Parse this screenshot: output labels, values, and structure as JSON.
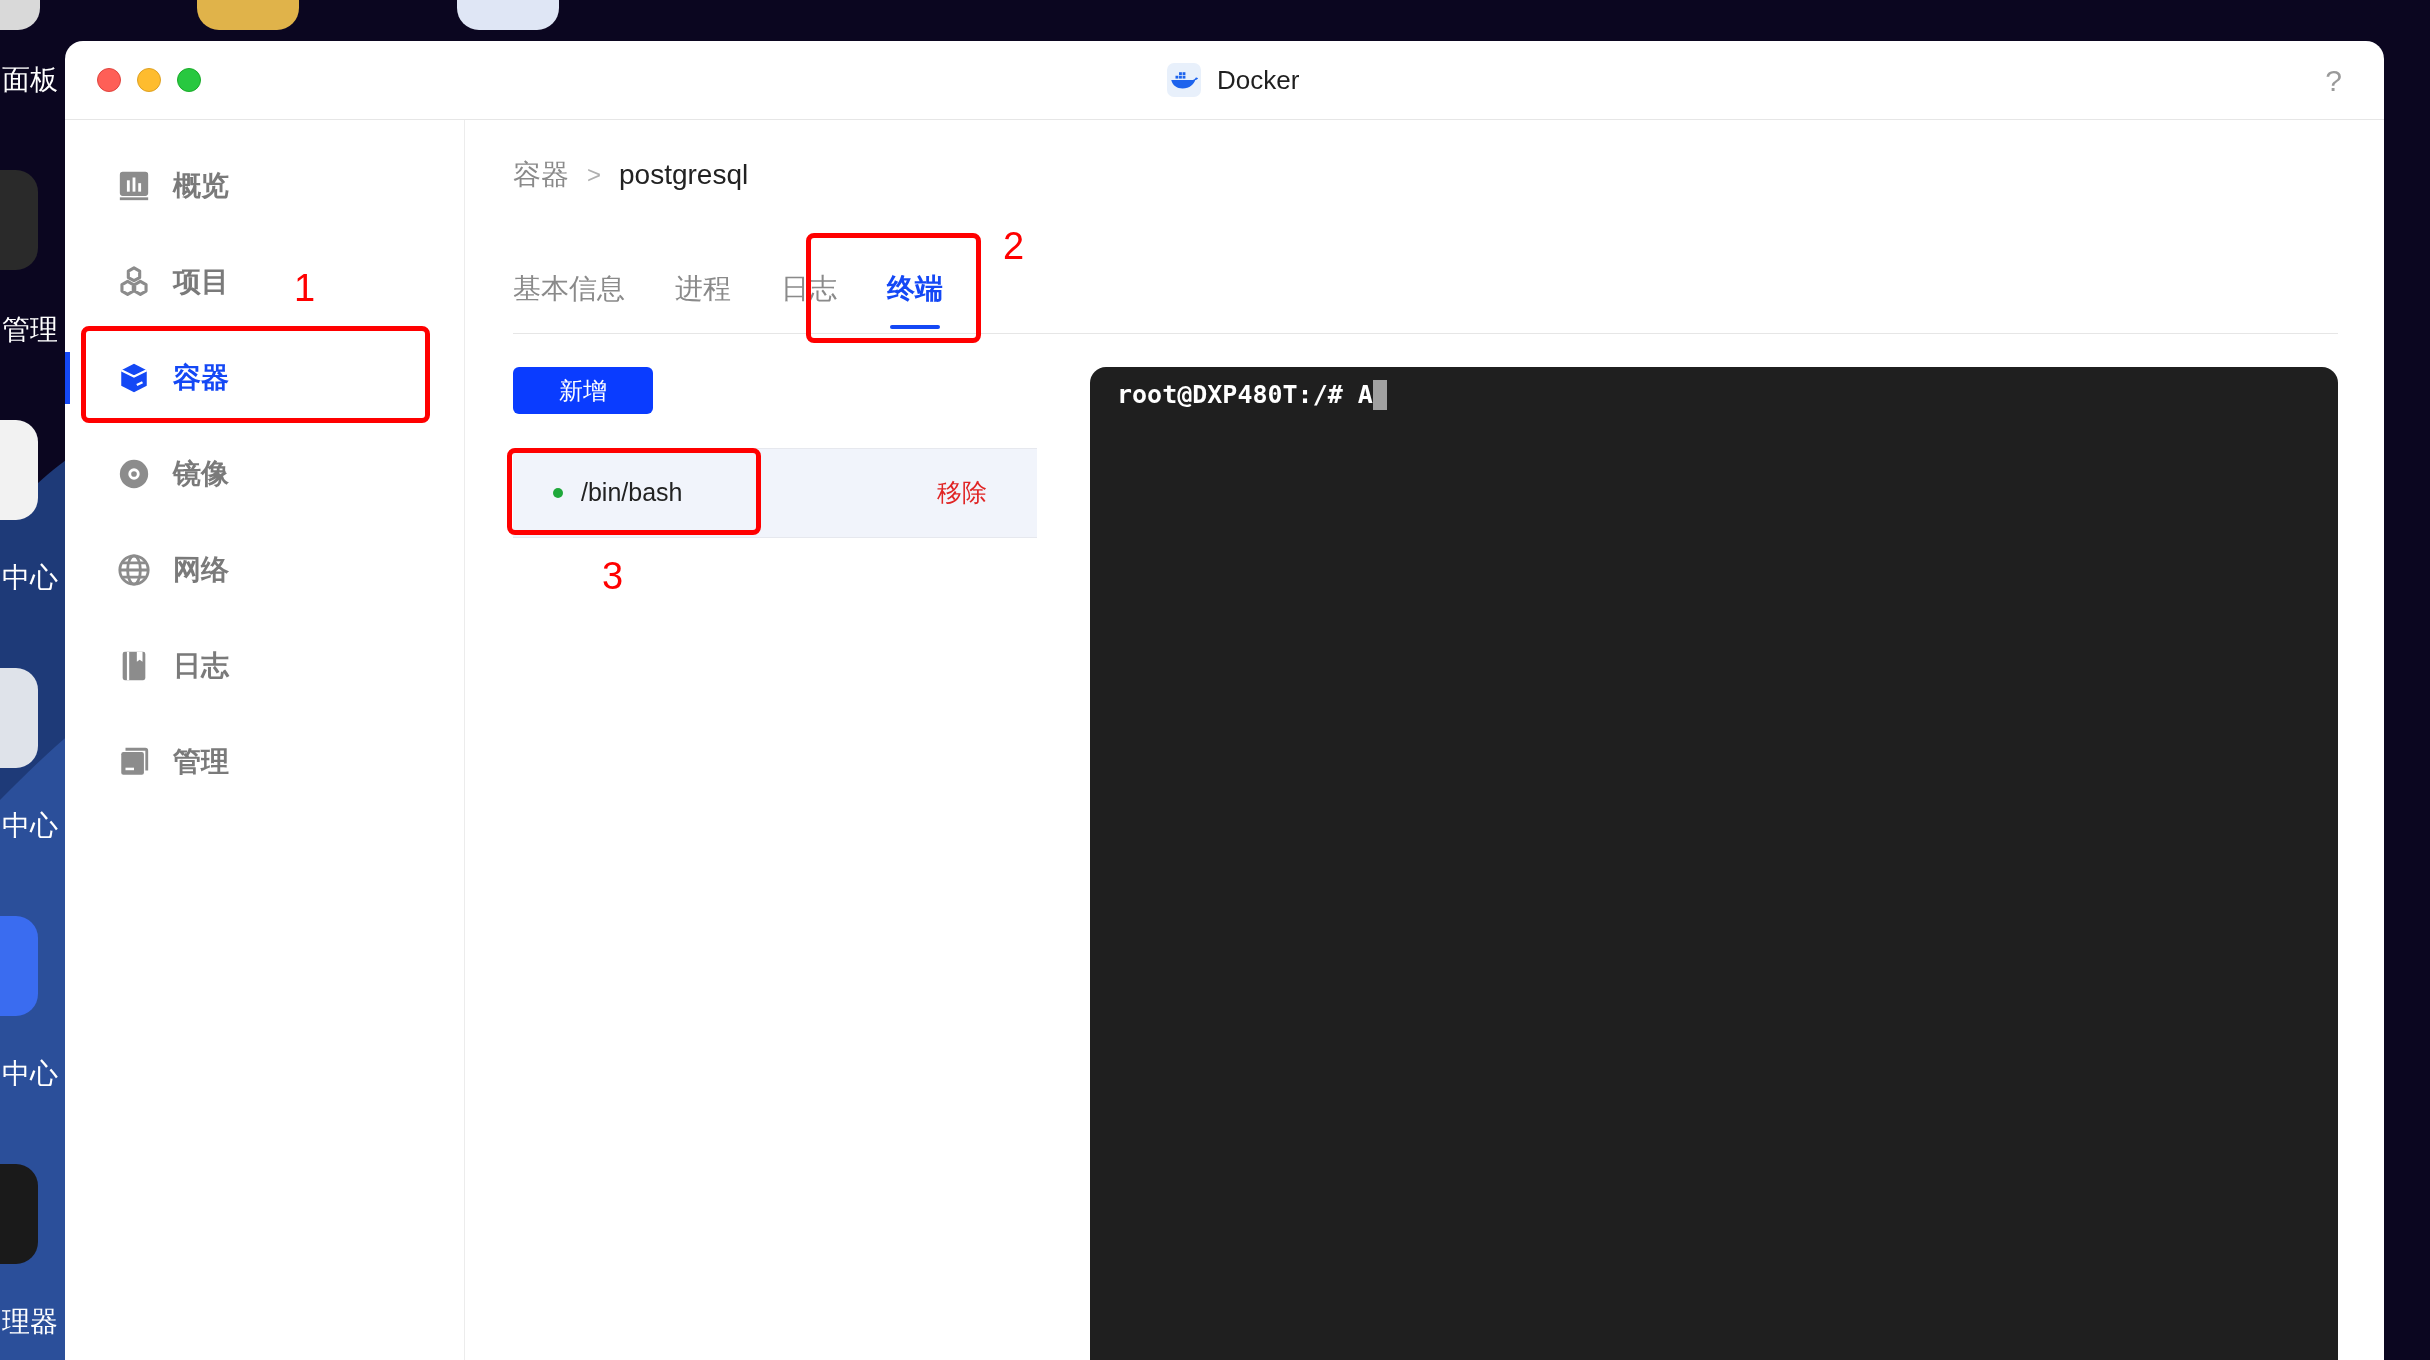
{
  "desktop": {
    "labels": [
      "面板",
      "管理",
      "中心",
      "中心",
      "中心",
      "理器"
    ]
  },
  "window": {
    "title": "Docker",
    "help": "?"
  },
  "sidebar": {
    "items": [
      {
        "label": "概览",
        "selected": false
      },
      {
        "label": "项目",
        "selected": false
      },
      {
        "label": "容器",
        "selected": true
      },
      {
        "label": "镜像",
        "selected": false
      },
      {
        "label": "网络",
        "selected": false
      },
      {
        "label": "日志",
        "selected": false
      },
      {
        "label": "管理",
        "selected": false
      }
    ]
  },
  "breadcrumb": {
    "items": [
      "容器",
      "postgresql"
    ],
    "separator": ">"
  },
  "tabs": [
    {
      "label": "基本信息",
      "selected": false
    },
    {
      "label": "进程",
      "selected": false
    },
    {
      "label": "日志",
      "selected": false
    },
    {
      "label": "终端",
      "selected": true
    }
  ],
  "new_button": "新增",
  "sessions": [
    {
      "command": "/bin/bash",
      "running": true,
      "selected": true,
      "action": "移除"
    }
  ],
  "terminal": {
    "text": "root@DXP480T:/# A",
    "cursor": true
  },
  "annotations": [
    {
      "label": "1"
    },
    {
      "label": "2"
    },
    {
      "label": "3"
    }
  ]
}
